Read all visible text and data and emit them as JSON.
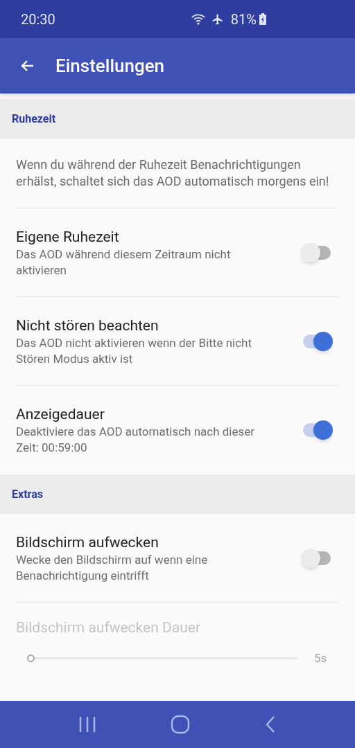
{
  "status_bar": {
    "time": "20:30",
    "battery": "81%"
  },
  "app_bar": {
    "title": "Einstellungen"
  },
  "sections": [
    {
      "title": "Ruhezeit",
      "items": [
        {
          "kind": "note",
          "text": "Wenn du während der Ruhezeit Benachrichtigungen erhälst, schaltet sich das AOD automatisch morgens ein!"
        },
        {
          "kind": "switch",
          "title": "Eigene Ruhezeit",
          "summary": "Das AOD während diesem Zeitraum nicht aktivieren",
          "on": false
        },
        {
          "kind": "switch",
          "title": "Nicht stören beachten",
          "summary": "Das AOD nicht aktivieren wenn der Bitte nicht Stören Modus aktiv ist",
          "on": true
        },
        {
          "kind": "switch",
          "title": "Anzeigedauer",
          "summary": "Deaktiviere das AOD automatisch nach dieser Zeit: 00:59:00",
          "on": true
        }
      ]
    },
    {
      "title": "Extras",
      "items": [
        {
          "kind": "switch",
          "title": "Bildschirm aufwecken",
          "summary": "Wecke den Bildschirm auf wenn eine Benachrichtigung eintrifft",
          "on": false
        },
        {
          "kind": "slider",
          "title": "Bildschirm aufwecken Dauer",
          "level": 0,
          "reading": "5s",
          "disabled": true
        }
      ]
    }
  ]
}
